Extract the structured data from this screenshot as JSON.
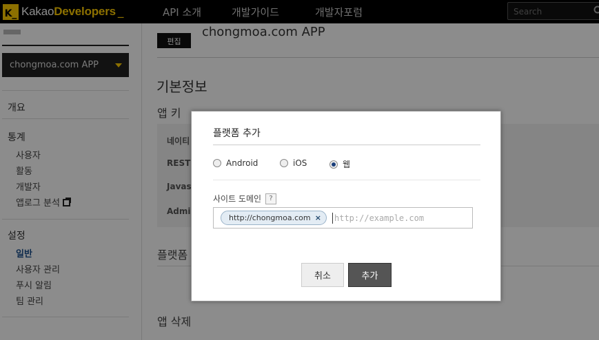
{
  "header": {
    "logo_k": "K_",
    "logo_prefix": "Kakao",
    "logo_bold": "Developers",
    "logo_cursor": "_",
    "nav": [
      "API 소개",
      "개발가이드",
      "개발자포럼"
    ],
    "search_placeholder": "Search"
  },
  "sidebar": {
    "app_name": "chongmoa.com APP",
    "overview": "개요",
    "stats_head": "통계",
    "stats_items": [
      "사용자",
      "활동",
      "개발자",
      "앱로그 분석"
    ],
    "settings_head": "설정",
    "settings_items": [
      "일반",
      "사용자 관리",
      "푸시 알림",
      "팀 관리"
    ]
  },
  "main": {
    "edit_label": "편집",
    "app_title": "chongmoa.com APP",
    "basic_info": "기본정보",
    "app_key": "앱 키",
    "key_labels": [
      "네이티",
      "REST",
      "Javas",
      "Admin"
    ],
    "platform": "플랫폼",
    "delete_app": "앱 삭제"
  },
  "modal": {
    "title": "플랫폼 추가",
    "radios": [
      "Android",
      "iOS",
      "웹"
    ],
    "selected": "웹",
    "domain_label": "사이트 도메인",
    "help": "?",
    "tag": "http://chongmoa.com",
    "tag_close": "×",
    "input_placeholder": "http://example.com",
    "cancel": "취소",
    "add": "추가"
  },
  "colors": {
    "accent": "#ffcd00",
    "active_link": "#1a4f8c",
    "primary_button": "#555555"
  }
}
